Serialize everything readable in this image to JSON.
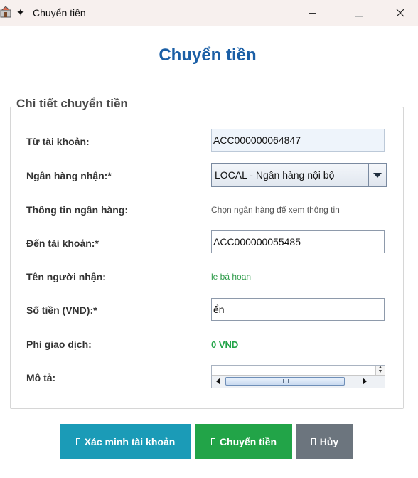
{
  "window": {
    "title": "Chuyển tiền",
    "title_icon": "✦"
  },
  "form": {
    "heading": "Chuyển tiền",
    "group_title": "Chi tiết chuyển tiền",
    "fields": {
      "from_account": {
        "label": "Từ tài khoản:",
        "value": "ACC000000064847"
      },
      "receiving_bank": {
        "label": "Ngân hàng nhận:*",
        "value": "LOCAL - Ngân hàng nội bộ"
      },
      "bank_info": {
        "label": "Thông tin ngân hàng:",
        "value": "Chọn ngân hàng để xem thông tin"
      },
      "to_account": {
        "label": "Đến tài khoản:*",
        "value": "ACC000000055485"
      },
      "recipient_name": {
        "label": "Tên người nhận:",
        "value": "le bá hoan"
      },
      "amount": {
        "label": "Số tiền (VND):*",
        "value": "ển"
      },
      "fee": {
        "label": "Phí giao dịch:",
        "value": "0 VND"
      },
      "description": {
        "label": "Mô tả:",
        "value": ""
      }
    }
  },
  "buttons": {
    "verify": "Xác minh tài khoản",
    "transfer": "Chuyển tiền",
    "cancel": "Hủy"
  },
  "colors": {
    "heading": "#1b5fa6",
    "verify_button": "#1b9bb7",
    "transfer_button": "#22a448",
    "cancel_button": "#6c757e",
    "recipient_text": "#2e9b4a",
    "fee_text": "#22a448"
  }
}
